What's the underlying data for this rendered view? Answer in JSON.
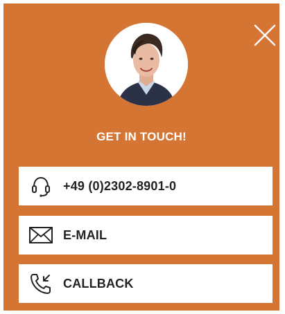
{
  "contact_panel": {
    "title": "GET IN TOUCH!",
    "accent_color": "#d47533",
    "close_icon": "close-icon",
    "avatar": "contact-person-photo",
    "actions": [
      {
        "icon": "headset-icon",
        "label": "+49 (0)2302-8901-0"
      },
      {
        "icon": "envelope-icon",
        "label": "E-MAIL"
      },
      {
        "icon": "phone-callback-icon",
        "label": "CALLBACK"
      }
    ]
  }
}
